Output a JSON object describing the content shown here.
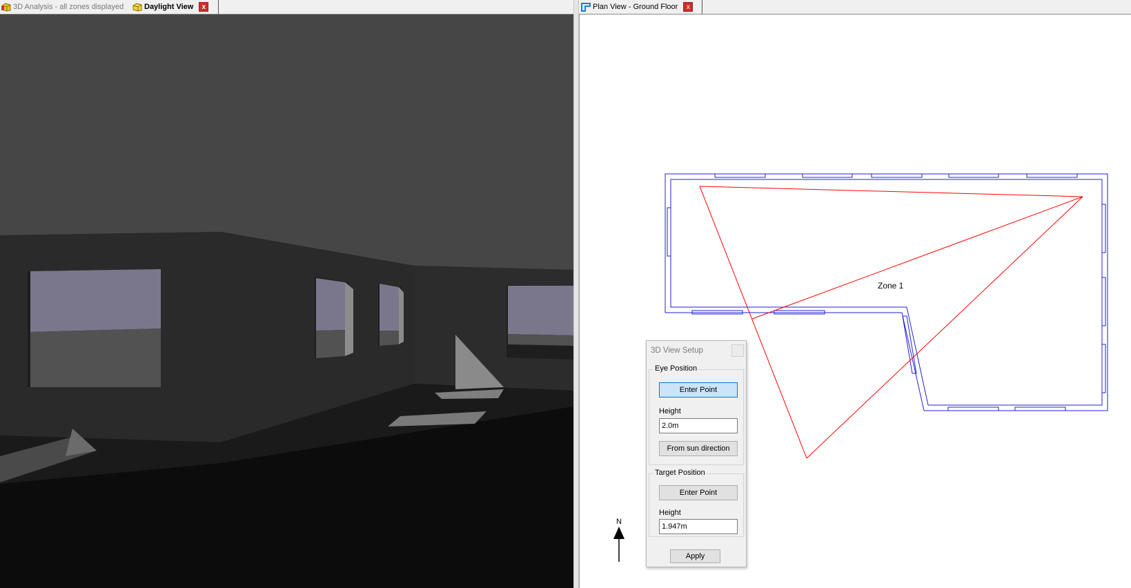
{
  "left_tabs": [
    {
      "label": "3D Analysis - all zones displayed",
      "active": false
    },
    {
      "label": "Daylight View",
      "active": true
    }
  ],
  "right_tabs": [
    {
      "label": "Plan View - Ground Floor",
      "active": true
    }
  ],
  "close_glyph": "x",
  "plan": {
    "zone_label": "Zone 1",
    "north_label": "N",
    "wall_color": "#1f1fd6",
    "view_cone_color": "#ff0000"
  },
  "dialog": {
    "title": "3D View Setup",
    "eye": {
      "group_label": "Eye Position",
      "enter_point": "Enter Point",
      "height_label": "Height",
      "height_value": "2.0m",
      "sun_button": "From sun direction"
    },
    "target": {
      "group_label": "Target Position",
      "enter_point": "Enter Point",
      "height_label": "Height",
      "height_value": "1.947m"
    },
    "apply": "Apply"
  },
  "icons": {
    "analysis_tab": "3d-cube-icon",
    "daylight_tab": "daylight-cube-icon",
    "plan_tab": "plan-view-icon",
    "close": "close-icon"
  },
  "colors": {
    "tab_close": "#c9302c",
    "focused_button": "#cce4f7"
  }
}
